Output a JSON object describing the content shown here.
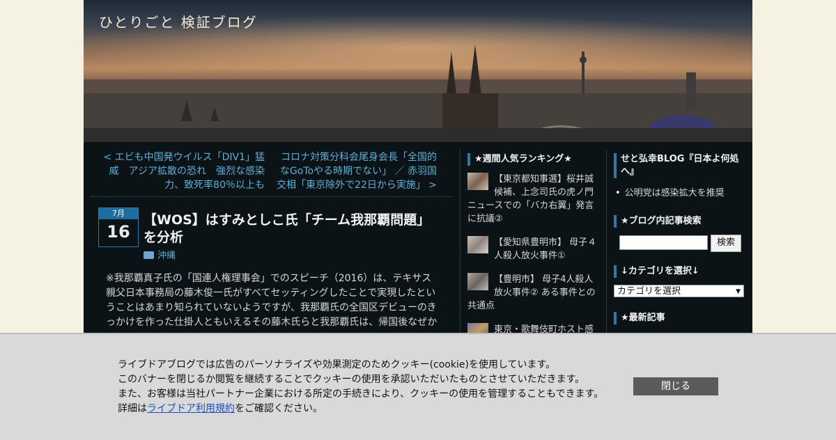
{
  "header": {
    "site_title": "ひとりごと 検証ブログ"
  },
  "pager": {
    "prev": "< エビも中国発ウイルス「DIV1」猛威　アジア拡散の恐れ　強烈な感染力、致死率80％以上も",
    "next": "コロナ対策分科会尾身会長「全国的なGoToやる時期でない」 ／ 赤羽国交相「東京除外で22日から実施」 >"
  },
  "article": {
    "month": "7月",
    "day": "16",
    "title": "【WOS】はすみとしこ氏「チーム我那覇問題」を分析",
    "category": "沖縄",
    "body": "※我那覇真子氏の「国連人権理事会」でのスピーチ（2016）は、テキサス親父日本事務局の藤木俊一氏がすべてセッティングしたことで実現したということはあまり知られていないようですが、我那覇氏の全国区デビューのきっかけを作った仕掛人ともいえるその藤木氏らと我那覇氏は、帰国後なぜか"
  },
  "ranking": {
    "heading": "★週間人気ランキング★",
    "items": [
      "【東京都知事選】桜井誠候補、上念司氏の虎ノ門ニュースでの「バカ右翼」発言に抗議②",
      "【愛知県豊明市】 母子４人殺人放火事件①",
      "【豊明市】 母子4人殺人放火事件② ある事件との共通点",
      "東京・歌舞伎町ホスト感"
    ]
  },
  "sidebar": {
    "blog_heading": "せと弘幸BLOG『日本よ何処へ』",
    "blog_item": "公明党は感染拡大を推奨",
    "search_heading": "★ブログ内記事検索",
    "search_button": "検索",
    "category_heading": "↓カテゴリを選択↓",
    "category_select": "カテゴリを選択",
    "latest_heading": "★最新記事"
  },
  "cookie": {
    "line1": "ライブドアブログでは広告のパーソナライズや効果測定のためクッキー(cookie)を使用しています。",
    "line2": "このバナーを閉じるか閲覧を継続することでクッキーの使用を承認いただいたものとさせていただきます。",
    "line3": "また、お客様は当社パートナー企業における所定の手続きにより、クッキーの使用を管理することもできます。",
    "line4_pre": "詳細は",
    "line4_link": "ライブドア利用規約",
    "line4_post": "をご確認ください。",
    "close": "閉じる"
  },
  "colors": {
    "accent": "#2b7aa8",
    "link": "#5fb0d8",
    "background": "#0b1316"
  }
}
